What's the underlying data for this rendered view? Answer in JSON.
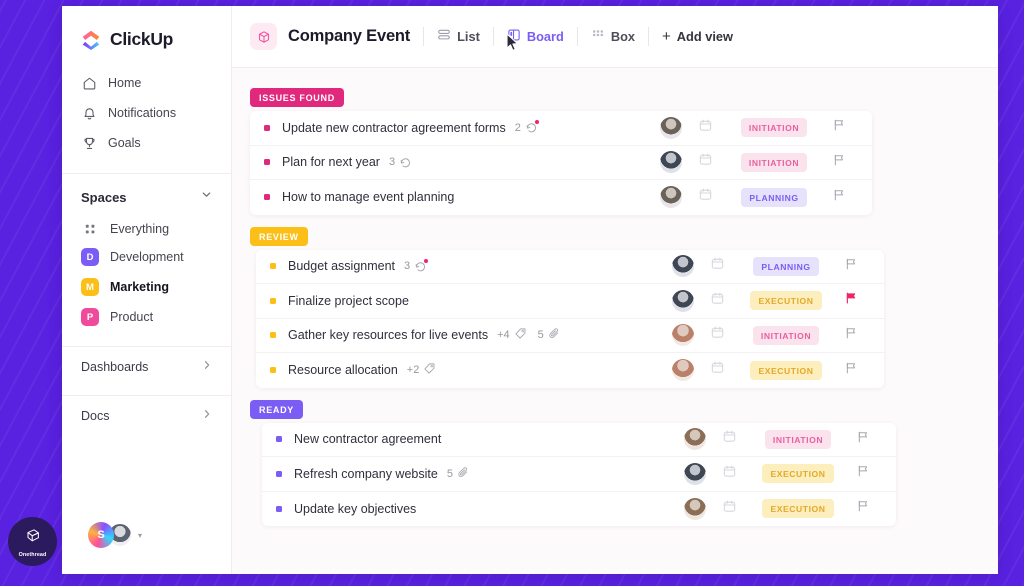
{
  "brand": {
    "name": "ClickUp",
    "logo_icon": "clickup-logo-icon"
  },
  "sidebar": {
    "nav": [
      {
        "label": "Home",
        "icon": "home-icon"
      },
      {
        "label": "Notifications",
        "icon": "bell-icon"
      },
      {
        "label": "Goals",
        "icon": "trophy-icon"
      }
    ],
    "spaces_title": "Spaces",
    "spaces_chevron_icon": "chevron-down-icon",
    "spaces": [
      {
        "label": "Everything",
        "icon": "grid-dots-icon",
        "type": "all"
      },
      {
        "label": "Development",
        "initial": "D",
        "color": "#7b5cf5"
      },
      {
        "label": "Marketing",
        "initial": "M",
        "color": "#fbbf18",
        "active": true
      },
      {
        "label": "Product",
        "initial": "P",
        "color": "#ef4a9b"
      }
    ],
    "rows": [
      {
        "label": "Dashboards",
        "chevron_icon": "chevron-right-icon"
      },
      {
        "label": "Docs",
        "chevron_icon": "chevron-right-icon"
      }
    ],
    "footer": {
      "avatar_initial": "S",
      "caret_icon": "caret-down-icon"
    }
  },
  "topbar": {
    "list_icon": "box-cube-icon",
    "title": "Company Event",
    "views": [
      {
        "label": "List",
        "icon": "list-icon",
        "active": false
      },
      {
        "label": "Board",
        "icon": "board-icon",
        "active": true
      },
      {
        "label": "Box",
        "icon": "box-grid-icon",
        "active": false
      }
    ],
    "add_view": {
      "label": "Add view",
      "icon": "plus-icon"
    }
  },
  "colors": {
    "issues_found": "#e0287d",
    "review": "#fbbf18",
    "ready": "#7b5cf5",
    "accent_purple": "#5921e0"
  },
  "board": {
    "groups": [
      {
        "name": "ISSUES FOUND",
        "badge_color": "#e0287d",
        "dot_color": "#e0287d",
        "tasks": [
          {
            "name": "Update new contractor agreement forms",
            "subtask_count": "2",
            "subtask_icon": "subtask-icon",
            "has_unread_dot": true,
            "avatar": "av-a",
            "date_icon": "calendar-icon",
            "status": "INITIATION",
            "status_bg": "#fbe3ee",
            "status_fg": "#e8609f",
            "flag_icon": "flag-outline-icon",
            "flagged": false
          },
          {
            "name": "Plan for next year",
            "subtask_count": "3",
            "subtask_icon": "subtask-icon",
            "has_unread_dot": false,
            "avatar": "av-b",
            "date_icon": "calendar-icon",
            "status": "INITIATION",
            "status_bg": "#fbe3ee",
            "status_fg": "#e8609f",
            "flag_icon": "flag-outline-icon",
            "flagged": false
          },
          {
            "name": "How to manage event planning",
            "avatar": "av-a",
            "date_icon": "calendar-icon",
            "status": "PLANNING",
            "status_bg": "#e6e2fb",
            "status_fg": "#7b5cf5",
            "flag_icon": "flag-outline-icon",
            "flagged": false
          }
        ]
      },
      {
        "name": "REVIEW",
        "badge_color": "#fbbf18",
        "dot_color": "#fbbf18",
        "tasks": [
          {
            "name": "Budget assignment",
            "subtask_count": "3",
            "subtask_icon": "subtask-icon",
            "has_unread_dot": true,
            "avatar": "av-b",
            "date_icon": "calendar-icon",
            "status": "PLANNING",
            "status_bg": "#e6e2fb",
            "status_fg": "#7b5cf5",
            "flag_icon": "flag-outline-icon",
            "flagged": false
          },
          {
            "name": "Finalize project scope",
            "avatar": "av-b",
            "date_icon": "calendar-icon",
            "status": "EXECUTION",
            "status_bg": "#fdeebd",
            "status_fg": "#e3a92a",
            "flag_icon": "flag-filled-icon",
            "flagged": true
          },
          {
            "name": "Gather key resources for live events",
            "tag_count": "+4",
            "tag_icon": "tag-icon",
            "attach_count": "5",
            "attach_icon": "paperclip-icon",
            "avatar": "av-d",
            "date_icon": "calendar-icon",
            "status": "INITIATION",
            "status_bg": "#fbe3ee",
            "status_fg": "#e8609f",
            "flag_icon": "flag-outline-icon",
            "flagged": false
          },
          {
            "name": "Resource allocation",
            "tag_count": "+2",
            "tag_icon": "tag-icon",
            "avatar": "av-d",
            "date_icon": "calendar-icon",
            "status": "EXECUTION",
            "status_bg": "#fdeebd",
            "status_fg": "#e3a92a",
            "flag_icon": "flag-outline-icon",
            "flagged": false
          }
        ]
      },
      {
        "name": "READY",
        "badge_color": "#7b5cf5",
        "dot_color": "#7b5cf5",
        "tasks": [
          {
            "name": "New contractor agreement",
            "avatar": "av-c",
            "date_icon": "calendar-icon",
            "status": "INITIATION",
            "status_bg": "#fbe3ee",
            "status_fg": "#e8609f",
            "flag_icon": "flag-outline-icon",
            "flagged": false
          },
          {
            "name": "Refresh company website",
            "attach_count": "5",
            "attach_icon": "paperclip-icon",
            "avatar": "av-b",
            "date_icon": "calendar-icon",
            "status": "EXECUTION",
            "status_bg": "#fdeebd",
            "status_fg": "#e3a92a",
            "flag_icon": "flag-outline-icon",
            "flagged": false
          },
          {
            "name": "Update key objectives",
            "avatar": "av-c",
            "date_icon": "calendar-icon",
            "status": "EXECUTION",
            "status_bg": "#fdeebd",
            "status_fg": "#e3a92a",
            "flag_icon": "flag-outline-icon",
            "flagged": false
          }
        ]
      }
    ]
  },
  "watermark": {
    "label": "Onethread",
    "icon": "onethread-logo-icon"
  }
}
